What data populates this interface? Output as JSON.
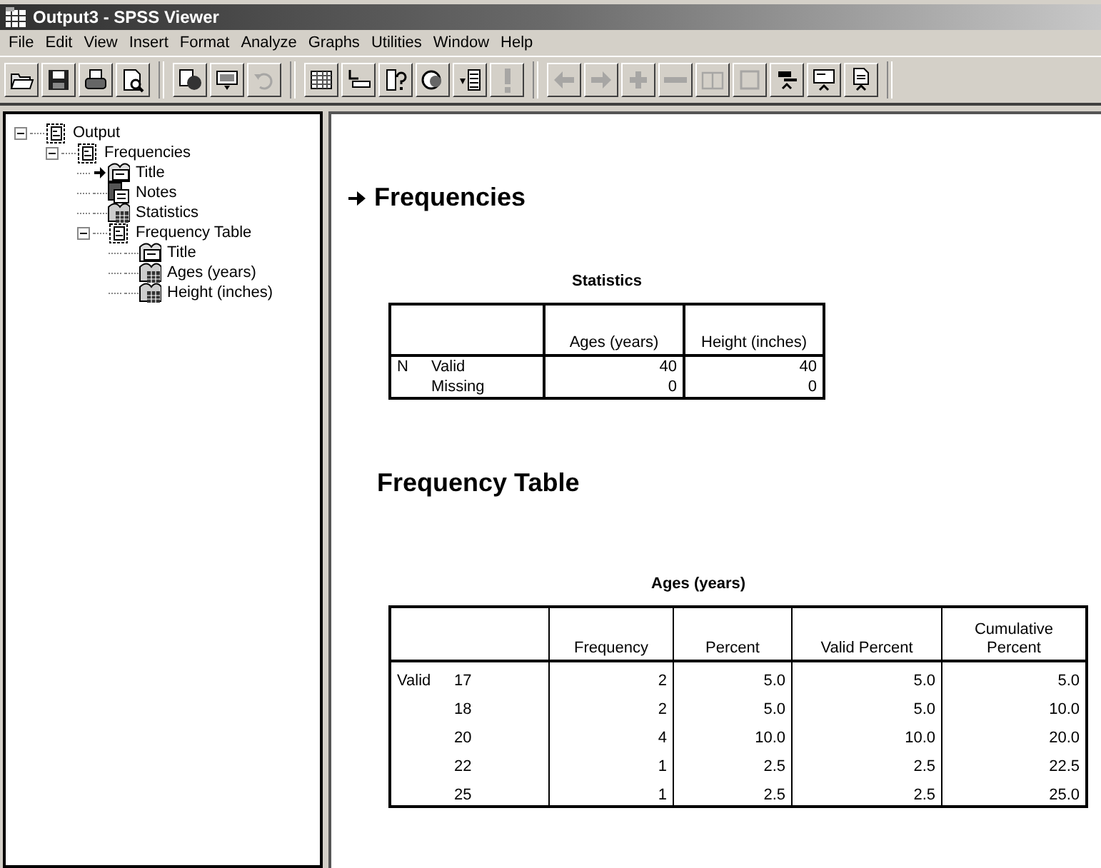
{
  "window": {
    "title": "Output3 - SPSS Viewer"
  },
  "menu": [
    "File",
    "Edit",
    "View",
    "Insert",
    "Format",
    "Analyze",
    "Graphs",
    "Utilities",
    "Window",
    "Help"
  ],
  "toolbar": [
    {
      "buttons": [
        {
          "kind": "open",
          "disabled": false
        },
        {
          "kind": "save",
          "disabled": false
        },
        {
          "kind": "print",
          "disabled": false
        },
        {
          "kind": "preview",
          "disabled": false
        }
      ]
    },
    {
      "buttons": [
        {
          "kind": "export",
          "disabled": false
        },
        {
          "kind": "dialog",
          "disabled": false
        },
        {
          "kind": "undo",
          "disabled": true
        }
      ]
    },
    {
      "buttons": [
        {
          "kind": "grid",
          "disabled": false
        },
        {
          "kind": "goto",
          "disabled": false
        },
        {
          "kind": "varinfo",
          "disabled": false
        },
        {
          "kind": "sets",
          "disabled": false
        },
        {
          "kind": "insert",
          "disabled": false
        },
        {
          "kind": "run",
          "disabled": true
        }
      ]
    },
    {
      "buttons": [
        {
          "kind": "back",
          "disabled": true
        },
        {
          "kind": "forward",
          "disabled": true
        },
        {
          "kind": "plus",
          "disabled": true
        },
        {
          "kind": "minus",
          "disabled": true
        },
        {
          "kind": "bookopen",
          "disabled": true
        },
        {
          "kind": "book",
          "disabled": true
        },
        {
          "kind": "heading",
          "disabled": false
        },
        {
          "kind": "title",
          "disabled": false
        },
        {
          "kind": "text",
          "disabled": false
        }
      ]
    }
  ],
  "outline": [
    {
      "label": "Output",
      "kind": "book",
      "expanded": true,
      "current": false,
      "children": [
        {
          "label": "Frequencies",
          "kind": "book",
          "expanded": true,
          "current": false,
          "children": [
            {
              "label": "Title",
              "kind": "title",
              "current": true
            },
            {
              "label": "Notes",
              "kind": "notes",
              "current": false
            },
            {
              "label": "Statistics",
              "kind": "table",
              "current": false
            },
            {
              "label": "Frequency Table",
              "kind": "book",
              "expanded": true,
              "current": false,
              "children": [
                {
                  "label": "Title",
                  "kind": "title",
                  "current": false
                },
                {
                  "label": "Ages (years)",
                  "kind": "table",
                  "current": false
                },
                {
                  "label": "Height (inches)",
                  "kind": "table",
                  "current": false
                }
              ]
            }
          ]
        }
      ]
    }
  ],
  "content": {
    "heading": "Frequencies",
    "heading_current": true,
    "statistics": {
      "title": "Statistics",
      "columns": [
        "Ages (years)",
        "Height (inches)"
      ],
      "rows": [
        {
          "group": "N",
          "label": "Valid",
          "values": [
            "40",
            "40"
          ]
        },
        {
          "group": "",
          "label": "Missing",
          "values": [
            "0",
            "0"
          ]
        }
      ]
    },
    "section": "Frequency Table",
    "ages": {
      "title": "Ages (years)",
      "columns": [
        "Frequency",
        "Percent",
        "Valid Percent",
        "Cumulative Percent"
      ],
      "rows": [
        {
          "group": "Valid",
          "label": "17",
          "values": [
            "2",
            "5.0",
            "5.0",
            "5.0"
          ]
        },
        {
          "group": "",
          "label": "18",
          "values": [
            "2",
            "5.0",
            "5.0",
            "10.0"
          ]
        },
        {
          "group": "",
          "label": "20",
          "values": [
            "4",
            "10.0",
            "10.0",
            "20.0"
          ]
        },
        {
          "group": "",
          "label": "22",
          "values": [
            "1",
            "2.5",
            "2.5",
            "22.5"
          ]
        },
        {
          "group": "",
          "label": "25",
          "values": [
            "1",
            "2.5",
            "2.5",
            "25.0"
          ]
        }
      ]
    }
  }
}
